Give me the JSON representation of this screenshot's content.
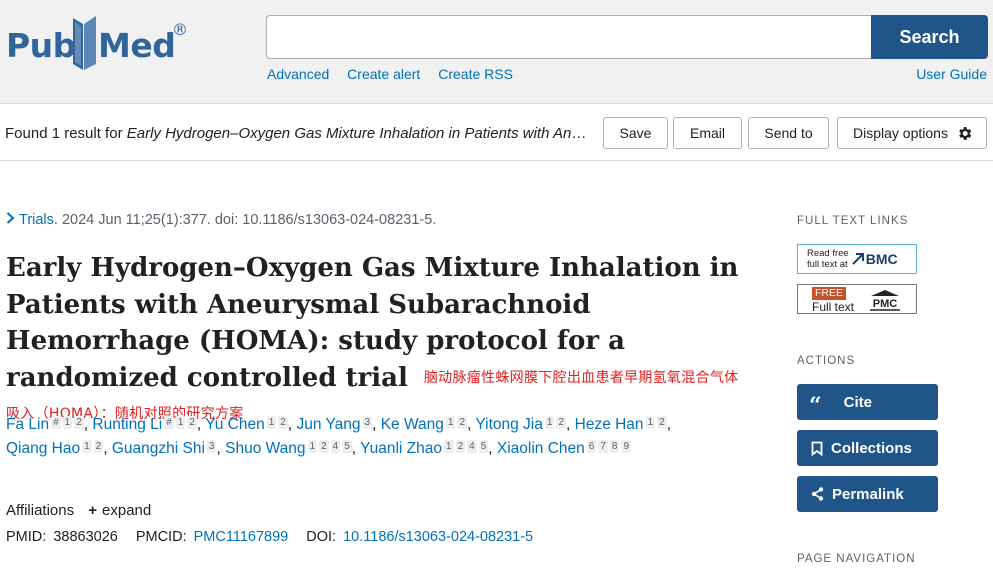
{
  "header": {
    "logo_pub": "Pub",
    "logo_med": "Med",
    "logo_reg": "®",
    "search_value": "",
    "search_button": "Search",
    "links": [
      "Advanced",
      "Create alert",
      "Create RSS"
    ],
    "user_guide": "User Guide"
  },
  "resultbar": {
    "found_prefix": "Found 1 result for ",
    "found_query": "Early Hydrogen–Oxygen Gas Mixture Inhalation in Patients with Aneurysmal Subarachnoid Hemorrhage (HOMA): study protocol for a randomized controlled trial",
    "save": "Save",
    "email": "Email",
    "send_to": "Send to",
    "display_options": "Display options"
  },
  "article": {
    "journal": "Trials.",
    "citation": " 2024 Jun 11;25(1):377. doi: 10.1186/s13063-024-08231-5.",
    "title": "Early Hydrogen–Oxygen Gas Mixture Inhalation in Patients with Aneurysmal Subarachnoid Hemorrhage (HOMA): study protocol for a randomized controlled trial",
    "title_translation": "脑动脉瘤性蛛网膜下腔出血患者早期氢氧混合气体吸入（HOMA）：随机对照的研究方案",
    "authors": [
      {
        "name": "Fa Lin",
        "sup": [
          "#",
          "1",
          "2"
        ]
      },
      {
        "name": "Runting Li",
        "sup": [
          "#",
          "1",
          "2"
        ]
      },
      {
        "name": "Yu Chen",
        "sup": [
          "1",
          "2"
        ]
      },
      {
        "name": "Jun Yang",
        "sup": [
          "3"
        ]
      },
      {
        "name": "Ke Wang",
        "sup": [
          "1",
          "2"
        ]
      },
      {
        "name": "Yitong Jia",
        "sup": [
          "1",
          "2"
        ]
      },
      {
        "name": "Heze Han",
        "sup": [
          "1",
          "2"
        ]
      },
      {
        "name": "Qiang Hao",
        "sup": [
          "1",
          "2"
        ]
      },
      {
        "name": "Guangzhi Shi",
        "sup": [
          "3"
        ]
      },
      {
        "name": "Shuo Wang",
        "sup": [
          "1",
          "2",
          "4",
          "5"
        ]
      },
      {
        "name": "Yuanli Zhao",
        "sup": [
          "1",
          "2",
          "4",
          "5"
        ]
      },
      {
        "name": "Xiaolin Chen",
        "sup": [
          "6",
          "7",
          "8",
          "9"
        ]
      }
    ],
    "affiliations_label": "Affiliations",
    "expand_label": "expand",
    "pmid_label": "PMID:",
    "pmid": "38863026",
    "pmcid_label": "PMCID:",
    "pmcid": "PMC11167899",
    "doi_label": "DOI:",
    "doi": "10.1186/s13063-024-08231-5"
  },
  "sidebar": {
    "full_text_heading": "FULL TEXT LINKS",
    "bmc_line1": "Read free",
    "bmc_line2": "full text at",
    "bmc_brand": "BMC",
    "pmc_free": "FREE",
    "pmc_full_text": "Full text",
    "pmc_brand": "PMC",
    "actions_heading": "ACTIONS",
    "cite": "Cite",
    "collections": "Collections",
    "permalink": "Permalink",
    "page_nav_heading": "PAGE NAVIGATION"
  },
  "colors": {
    "primary_button": "#20558a",
    "link": "#0071bc",
    "logo": "#326599",
    "translation_text": "#e02020"
  }
}
